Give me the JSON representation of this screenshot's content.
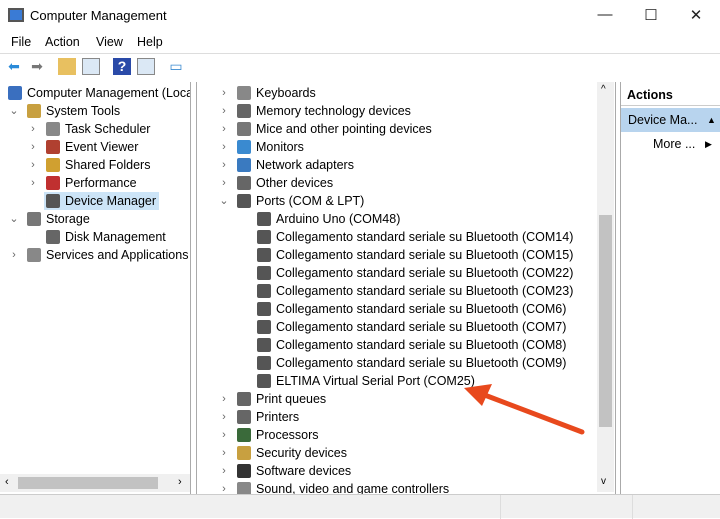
{
  "window": {
    "title": "Computer Management",
    "min": "—",
    "max": "☐",
    "close": "✕"
  },
  "menu": [
    "File",
    "Action",
    "View",
    "Help"
  ],
  "toolbar": [
    "back-icon",
    "forward-icon",
    "up-icon",
    "show-hide-tree-icon",
    "help-icon",
    "show-hide-action-pane-icon",
    "monitor-icon"
  ],
  "tree": [
    {
      "label": "Computer Management (Local",
      "level": 0,
      "chev": "",
      "icon": "#3a6fbf"
    },
    {
      "label": "System Tools",
      "level": 1,
      "chev": "⌄",
      "icon": "#c8a040"
    },
    {
      "label": "Task Scheduler",
      "level": 2,
      "chev": "›",
      "icon": "#888"
    },
    {
      "label": "Event Viewer",
      "level": 2,
      "chev": "›",
      "icon": "#b04030"
    },
    {
      "label": "Shared Folders",
      "level": 2,
      "chev": "›",
      "icon": "#d0a030"
    },
    {
      "label": "Performance",
      "level": 2,
      "chev": "›",
      "icon": "#c03030"
    },
    {
      "label": "Device Manager",
      "level": 2,
      "chev": "",
      "icon": "#555",
      "selected": true
    },
    {
      "label": "Storage",
      "level": 1,
      "chev": "⌄",
      "icon": "#777"
    },
    {
      "label": "Disk Management",
      "level": 2,
      "chev": "",
      "icon": "#666"
    },
    {
      "label": "Services and Applications",
      "level": 1,
      "chev": "›",
      "icon": "#888"
    }
  ],
  "devices": [
    {
      "label": "Keyboards",
      "level": 0,
      "chev": "›",
      "icon": "#888"
    },
    {
      "label": "Memory technology devices",
      "level": 0,
      "chev": "›",
      "icon": "#666"
    },
    {
      "label": "Mice and other pointing devices",
      "level": 0,
      "chev": "›",
      "icon": "#777"
    },
    {
      "label": "Monitors",
      "level": 0,
      "chev": "›",
      "icon": "#3a8ad0"
    },
    {
      "label": "Network adapters",
      "level": 0,
      "chev": "›",
      "icon": "#3a7ac0"
    },
    {
      "label": "Other devices",
      "level": 0,
      "chev": "›",
      "icon": "#666"
    },
    {
      "label": "Ports (COM & LPT)",
      "level": 0,
      "chev": "⌄",
      "icon": "#555"
    },
    {
      "label": "Arduino Uno (COM48)",
      "level": 1,
      "chev": "",
      "icon": "#555"
    },
    {
      "label": "Collegamento standard seriale su Bluetooth (COM14)",
      "level": 1,
      "chev": "",
      "icon": "#555"
    },
    {
      "label": "Collegamento standard seriale su Bluetooth (COM15)",
      "level": 1,
      "chev": "",
      "icon": "#555"
    },
    {
      "label": "Collegamento standard seriale su Bluetooth (COM22)",
      "level": 1,
      "chev": "",
      "icon": "#555"
    },
    {
      "label": "Collegamento standard seriale su Bluetooth (COM23)",
      "level": 1,
      "chev": "",
      "icon": "#555"
    },
    {
      "label": "Collegamento standard seriale su Bluetooth (COM6)",
      "level": 1,
      "chev": "",
      "icon": "#555"
    },
    {
      "label": "Collegamento standard seriale su Bluetooth (COM7)",
      "level": 1,
      "chev": "",
      "icon": "#555"
    },
    {
      "label": "Collegamento standard seriale su Bluetooth (COM8)",
      "level": 1,
      "chev": "",
      "icon": "#555"
    },
    {
      "label": "Collegamento standard seriale su Bluetooth (COM9)",
      "level": 1,
      "chev": "",
      "icon": "#555"
    },
    {
      "label": "ELTIMA Virtual Serial Port (COM25)",
      "level": 1,
      "chev": "",
      "icon": "#555"
    },
    {
      "label": "Print queues",
      "level": 0,
      "chev": "›",
      "icon": "#666"
    },
    {
      "label": "Printers",
      "level": 0,
      "chev": "›",
      "icon": "#666"
    },
    {
      "label": "Processors",
      "level": 0,
      "chev": "›",
      "icon": "#3a6a3a"
    },
    {
      "label": "Security devices",
      "level": 0,
      "chev": "›",
      "icon": "#c8a040"
    },
    {
      "label": "Software devices",
      "level": 0,
      "chev": "›",
      "icon": "#333"
    },
    {
      "label": "Sound, video and game controllers",
      "level": 0,
      "chev": "›",
      "icon": "#888"
    }
  ],
  "actions": {
    "header": "Actions",
    "section": "Device Ma...",
    "section_arrow": "▲",
    "more": "More ...",
    "more_arrow": "▶"
  },
  "annotation_color": "#e8491d"
}
